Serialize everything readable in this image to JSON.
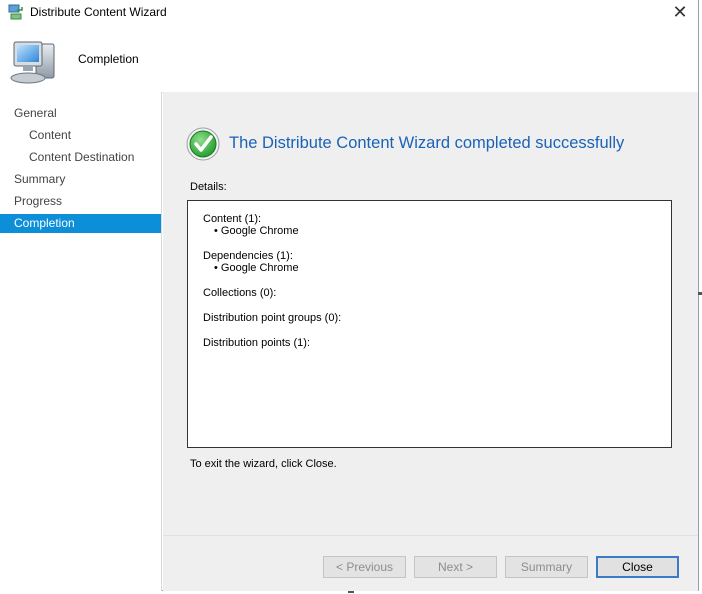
{
  "window": {
    "title": "Distribute Content Wizard",
    "close_glyph": "✕"
  },
  "header": {
    "title": "Completion",
    "icon": "computer-icon"
  },
  "nav": {
    "items": [
      {
        "label": "General",
        "indent": 0,
        "selected": false
      },
      {
        "label": "Content",
        "indent": 1,
        "selected": false
      },
      {
        "label": "Content Destination",
        "indent": 1,
        "selected": false
      },
      {
        "label": "Summary",
        "indent": 0,
        "selected": false
      },
      {
        "label": "Progress",
        "indent": 0,
        "selected": false
      },
      {
        "label": "Completion",
        "indent": 0,
        "selected": true
      }
    ]
  },
  "main": {
    "success_message": "The Distribute Content Wizard completed successfully",
    "details_label": "Details:",
    "details": {
      "content_header": "Content (1):",
      "content_items": [
        "Google Chrome"
      ],
      "dependencies_header": "Dependencies (1):",
      "dependencies_items": [
        "Google Chrome"
      ],
      "collections": "Collections (0):",
      "dp_groups": "Distribution point groups (0):",
      "dp": "Distribution points (1):"
    },
    "exit_text": "To exit the wizard, click Close."
  },
  "buttons": {
    "previous": "< Previous",
    "next": "Next >",
    "summary": "Summary",
    "close": "Close"
  },
  "colors": {
    "selection": "#0c8fd8",
    "success_text": "#1a62b8",
    "panel_bg": "#efefef"
  }
}
